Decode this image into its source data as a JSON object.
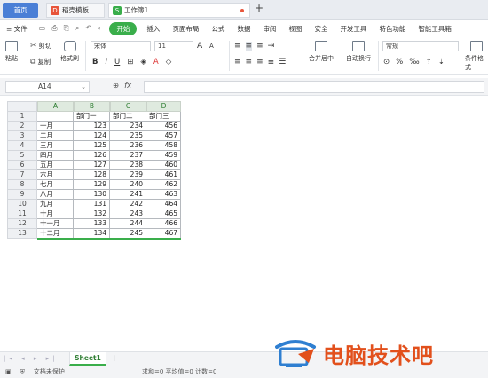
{
  "tabs": {
    "home": "首页",
    "doc": "稻壳模板",
    "workbook": "工作簿1",
    "add": "+"
  },
  "menu": {
    "file": "≡ 文件",
    "start": "开始",
    "items": [
      "插入",
      "页面布局",
      "公式",
      "数据",
      "审阅",
      "视图",
      "安全",
      "开发工具",
      "特色功能",
      "智能工具箱"
    ]
  },
  "ribbon": {
    "paste": "粘贴",
    "cut": "剪切",
    "copy": "复制",
    "format_painter": "格式刷",
    "font_name": "宋体",
    "font_size": "11",
    "font_grow": "A",
    "font_shrink": "A",
    "merge": "合并居中",
    "wrap": "自动换行",
    "number_format": "常规",
    "conditional": "条件格式",
    "bold": "B",
    "italic": "I",
    "underline": "U",
    "percent": "%"
  },
  "formula_bar": {
    "name_box": "A14",
    "fx": "fx",
    "zoom_icon": "⊕",
    "value": ""
  },
  "grid": {
    "columns": [
      "A",
      "B",
      "C",
      "D"
    ],
    "rows": [
      [
        "",
        "部门一",
        "部门二",
        "部门三"
      ],
      [
        "一月",
        "123",
        "234",
        "456"
      ],
      [
        "二月",
        "124",
        "235",
        "457"
      ],
      [
        "三月",
        "125",
        "236",
        "458"
      ],
      [
        "四月",
        "126",
        "237",
        "459"
      ],
      [
        "五月",
        "127",
        "238",
        "460"
      ],
      [
        "六月",
        "128",
        "239",
        "461"
      ],
      [
        "七月",
        "129",
        "240",
        "462"
      ],
      [
        "八月",
        "130",
        "241",
        "463"
      ],
      [
        "九月",
        "131",
        "242",
        "464"
      ],
      [
        "十月",
        "132",
        "243",
        "465"
      ],
      [
        "十一月",
        "133",
        "244",
        "466"
      ],
      [
        "十二月",
        "134",
        "245",
        "467"
      ]
    ]
  },
  "sheets": {
    "active": "Sheet1",
    "add": "+"
  },
  "status": {
    "protect": "文档未保护",
    "summary": "求和=0  平均值=0  计数=0"
  },
  "watermark": {
    "text": "电脑技术吧"
  },
  "colors": {
    "accent_green": "#3aae4b",
    "home_tab_blue": "#4a7fd6",
    "watermark_orange": "#e2501c",
    "watermark_blue": "#2f7fd1"
  }
}
